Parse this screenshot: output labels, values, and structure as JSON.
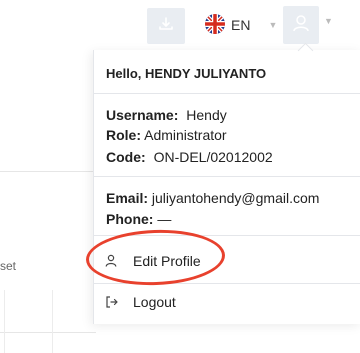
{
  "header": {
    "language_label": "EN"
  },
  "background": {
    "partial_text": "set"
  },
  "profile_menu": {
    "greeting": "Hello, HENDY JULIYANTO",
    "username_label": "Username:",
    "username_value": "Hendy",
    "role_label": "Role:",
    "role_value": "Administrator",
    "code_label": "Code:",
    "code_value": "ON-DEL/02012002",
    "email_label": "Email:",
    "email_value": "juliyantohendy@gmail.com",
    "phone_label": "Phone:",
    "phone_value": "—",
    "edit_profile_label": "Edit Profile",
    "logout_label": "Logout"
  },
  "annotation": {
    "color": "#e8412d"
  }
}
